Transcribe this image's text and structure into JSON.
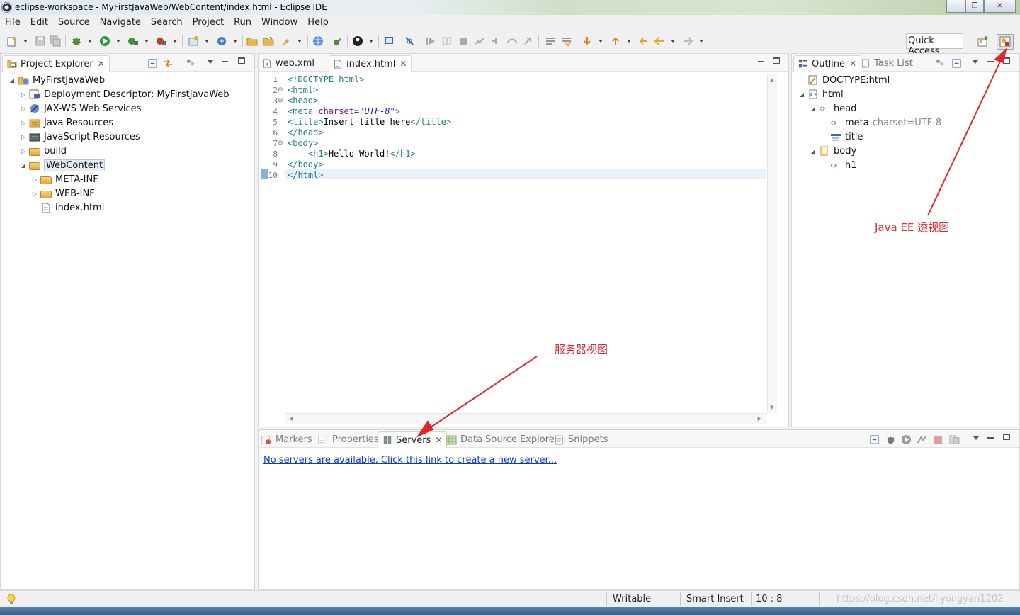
{
  "window": {
    "title": "eclipse-workspace - MyFirstJavaWeb/WebContent/index.html - Eclipse IDE",
    "minimize_glyph": "—",
    "restore_glyph": "❐",
    "close_glyph": "✕"
  },
  "menu": [
    "File",
    "Edit",
    "Source",
    "Navigate",
    "Search",
    "Project",
    "Run",
    "Window",
    "Help"
  ],
  "toolbar": {
    "quick_access": "Quick Access"
  },
  "project_explorer": {
    "title": "Project Explorer",
    "tree": [
      {
        "label": "MyFirstJavaWeb",
        "level": 0,
        "expanded": true
      },
      {
        "label": "Deployment Descriptor: MyFirstJavaWeb",
        "level": 1
      },
      {
        "label": "JAX-WS Web Services",
        "level": 1
      },
      {
        "label": "Java Resources",
        "level": 1
      },
      {
        "label": "JavaScript Resources",
        "level": 1
      },
      {
        "label": "build",
        "level": 1
      },
      {
        "label": "WebContent",
        "level": 1,
        "expanded": true,
        "selected": true
      },
      {
        "label": "META-INF",
        "level": 2
      },
      {
        "label": "WEB-INF",
        "level": 2
      },
      {
        "label": "index.html",
        "level": 2
      }
    ]
  },
  "editor": {
    "tabs": [
      {
        "label": "web.xml",
        "active": false
      },
      {
        "label": "index.html",
        "active": true
      }
    ],
    "line_numbers": [
      "1",
      "2",
      "3",
      "4",
      "5",
      "6",
      "7",
      "8",
      "9",
      "10"
    ],
    "lines": [
      [
        {
          "t": "<!DOCTYPE html>",
          "c": "kw"
        }
      ],
      [
        {
          "t": "<html>",
          "c": "tagc"
        }
      ],
      [
        {
          "t": "<head>",
          "c": "tagc"
        }
      ],
      [
        {
          "t": "<meta ",
          "c": "tagc"
        },
        {
          "t": "charset=",
          "c": "attr"
        },
        {
          "t": "\"UTF-8\"",
          "c": "str"
        },
        {
          "t": ">",
          "c": "tagc"
        }
      ],
      [
        {
          "t": "<title>",
          "c": "tagc"
        },
        {
          "t": "Insert title here",
          "c": "txt"
        },
        {
          "t": "</title>",
          "c": "tagc"
        }
      ],
      [
        {
          "t": "</head>",
          "c": "tagc"
        }
      ],
      [
        {
          "t": "<body>",
          "c": "tagc"
        }
      ],
      [
        {
          "t": "    ",
          "c": "txt"
        },
        {
          "t": "<h1>",
          "c": "tagc"
        },
        {
          "t": "Hello World!",
          "c": "txt"
        },
        {
          "t": "</h1>",
          "c": "tagc"
        }
      ],
      [
        {
          "t": "</body>",
          "c": "tagc"
        }
      ],
      [
        {
          "t": "</html>",
          "c": "tagc"
        }
      ]
    ]
  },
  "outline": {
    "tabs": [
      {
        "label": "Outline",
        "active": true
      },
      {
        "label": "Task List",
        "active": false
      }
    ],
    "tree": [
      {
        "label": "DOCTYPE:html",
        "level": 0
      },
      {
        "label": "html",
        "level": 0
      },
      {
        "label": "head",
        "level": 1
      },
      {
        "label": "meta",
        "attr": "charset=UTF-8",
        "level": 2
      },
      {
        "label": "title",
        "level": 2
      },
      {
        "label": "body",
        "level": 1
      },
      {
        "label": "h1",
        "level": 2
      }
    ]
  },
  "bottom_panel": {
    "tabs": [
      {
        "label": "Markers",
        "active": false
      },
      {
        "label": "Properties",
        "active": false
      },
      {
        "label": "Servers",
        "active": true
      },
      {
        "label": "Data Source Explorer",
        "active": false
      },
      {
        "label": "Snippets",
        "active": false
      }
    ],
    "link": "No servers are available. Click this link to create a new server..."
  },
  "annotations": {
    "perspective": "Java EE 透视图",
    "servers": "服务器视图"
  },
  "status": {
    "writable": "Writable",
    "insert_mode": "Smart Insert",
    "position": "10 : 8",
    "watermark": "https://blog.csdn.net/liyongyan1202"
  },
  "colors": {
    "annotation": "#e0282a",
    "link": "#0a3cc7",
    "tag": "#1d7d86",
    "attribute": "#7a0d7a",
    "string": "#2a00ff"
  }
}
